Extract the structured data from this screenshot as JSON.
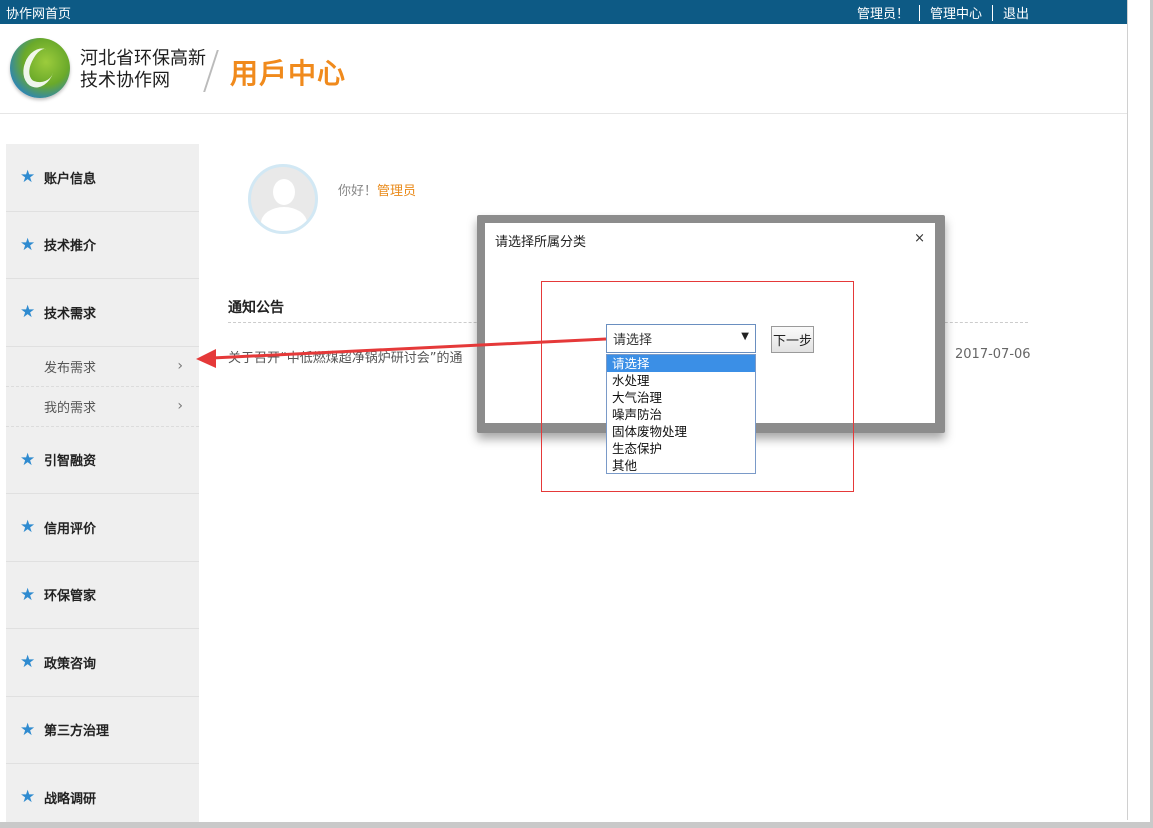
{
  "topbar": {
    "home": "协作网首页",
    "admin": "管理员！",
    "admin_center": "管理中心",
    "logout": "退出"
  },
  "header": {
    "org_line1": "河北省环保高新",
    "org_line2": "技术协作网",
    "section": "用戶中心"
  },
  "sidebar": {
    "items": [
      {
        "label": "账户信息"
      },
      {
        "label": "技术推介"
      },
      {
        "label": "技术需求"
      },
      {
        "label": "引智融资"
      },
      {
        "label": "信用评价"
      },
      {
        "label": "环保管家"
      },
      {
        "label": "政策咨询"
      },
      {
        "label": "第三方治理"
      },
      {
        "label": "战略调研"
      }
    ],
    "subitems": [
      {
        "label": "发布需求"
      },
      {
        "label": "我的需求"
      }
    ]
  },
  "main": {
    "greeting": "你好！",
    "username": "管理员",
    "notice_title": "通知公告",
    "notice_item": "关于召开“中低燃煤超净锅炉研讨会”的通",
    "notice_date": "2017-07-06"
  },
  "modal": {
    "title": "请选择所属分类",
    "close": "×",
    "select_value": "请选择",
    "next_button": "下一步",
    "options": [
      "请选择",
      "水处理",
      "大气治理",
      "噪声防治",
      "固体废物处理",
      "生态保护",
      "其他"
    ]
  },
  "colors": {
    "topbar": "#0d5a85",
    "accent_orange": "#f08a1c",
    "star_blue": "#2f8bd0",
    "annotation_red": "#e53939"
  }
}
